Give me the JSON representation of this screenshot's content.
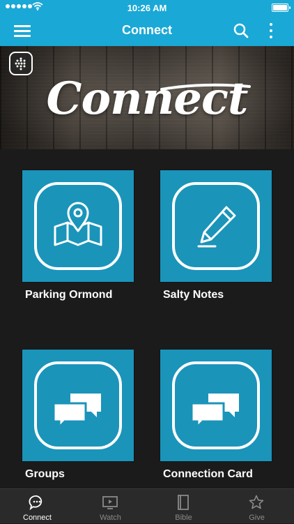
{
  "status_bar": {
    "time": "10:26 AM",
    "battery_level": 1.0
  },
  "nav": {
    "title": "Connect",
    "icons": [
      "menu-icon",
      "search-icon",
      "more-vertical-icon"
    ]
  },
  "banner": {
    "title": "Connect"
  },
  "tiles": [
    {
      "label": "Parking Ormond",
      "icon": "map-pin-icon"
    },
    {
      "label": "Salty Notes",
      "icon": "pencil-icon"
    },
    {
      "label": "Groups",
      "icon": "chat-bubbles-icon"
    },
    {
      "label": "Connection Card",
      "icon": "chat-bubbles-icon"
    }
  ],
  "tab_bar": {
    "items": [
      {
        "label": "Connect",
        "icon": "chat-icon",
        "active": true
      },
      {
        "label": "Watch",
        "icon": "video-icon",
        "active": false
      },
      {
        "label": "Bible",
        "icon": "book-icon",
        "active": false
      },
      {
        "label": "Give",
        "icon": "star-icon",
        "active": false
      }
    ]
  },
  "colors": {
    "accent": "#1aa8d6",
    "tile": "#1b94ba",
    "background": "#1b1b1b",
    "tab_bar": "#2a2a2a"
  }
}
